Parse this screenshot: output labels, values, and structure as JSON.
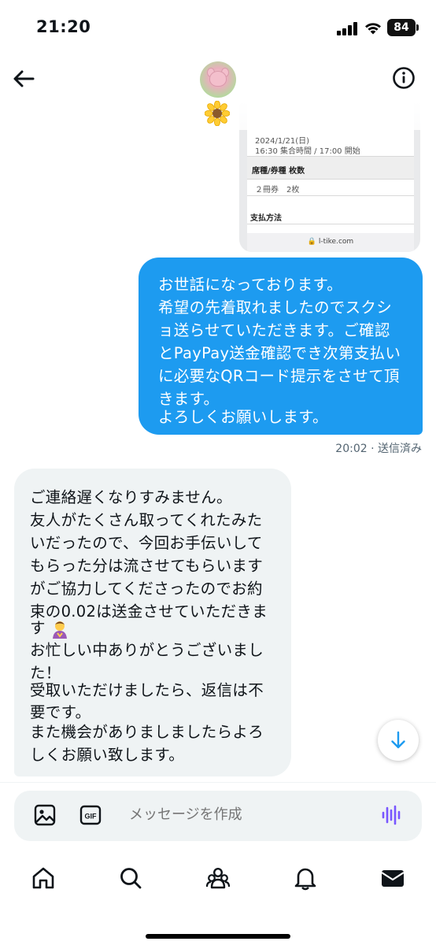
{
  "status_bar": {
    "time": "21:20",
    "battery": "84"
  },
  "header": {
    "back_icon": "arrow-left-icon",
    "avatar_alt": "profile avatar",
    "name_emoji": "sunflower-emoji",
    "info_icon": "info-icon"
  },
  "attachment": {
    "date": "2024/1/21(日)",
    "time": "16:30 集合時間 / 17:00 開始",
    "seat_header": "席種/券種 枚数",
    "seat_value": "２冊券　2枚",
    "payment_header": "支払方法",
    "url": "l-tike.com"
  },
  "messages": {
    "outgoing": {
      "lines": [
        "お世話になっております。",
        "希望の先着取れましたのでスクシ",
        "ョ送らせていただきます。ご確認",
        "とPayPay送金確認でき次第支払い",
        "に必要なQRコード提示をさせて頂",
        "きます。",
        "よろしくお願いします。"
      ],
      "meta": "20:02 · 送信済み"
    },
    "incoming": {
      "lines": [
        "ご連絡遅くなりすみません。",
        "友人がたくさん取ってくれたみた",
        "いだったので、今回お手伝いして",
        "もらった分は流させてもらいます",
        "がご協力してくださったのでお約",
        "束の0.02は送金させていただきま",
        "す",
        "お忙しい中ありがとうございまし",
        "た！",
        "受取いただけましたら、返信は不",
        "要です。",
        "また機会がありましましたらよろ",
        "しくお願い致します。"
      ]
    }
  },
  "composer": {
    "placeholder": "メッセージを作成",
    "gif_label": "GIF"
  },
  "nav": {
    "items": [
      "home-icon",
      "search-icon",
      "communities-icon",
      "notifications-icon",
      "messages-icon"
    ]
  },
  "colors": {
    "accent": "#1d9bf0",
    "incoming_bubble": "#eff3f4",
    "secondary_text": "#536471",
    "voice_icon": "#7856ff"
  }
}
